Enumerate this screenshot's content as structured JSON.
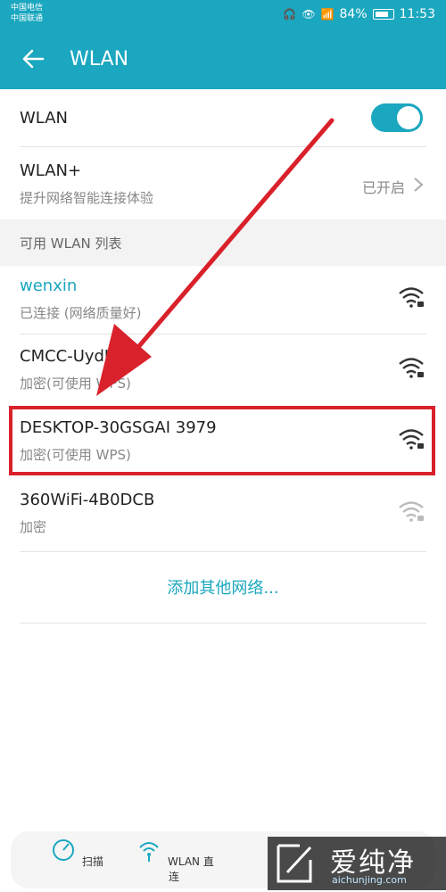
{
  "status_bar": {
    "carrier_1": "中国电信",
    "carrier_2": "中国联通",
    "battery": "84%",
    "time": "11:53"
  },
  "header": {
    "title": "WLAN"
  },
  "wlan_toggle": {
    "label": "WLAN",
    "on": true
  },
  "wlan_plus": {
    "label": "WLAN+",
    "subtitle": "提升网络智能连接体验",
    "status": "已开启"
  },
  "section": {
    "label": "可用 WLAN 列表"
  },
  "networks": [
    {
      "name": "wenxin",
      "status": "已连接 (网络质量好)",
      "connected": true
    },
    {
      "name": "CMCC-UydU",
      "status": "加密(可使用 WPS)",
      "connected": false
    },
    {
      "name": "DESKTOP-30GSGAI 3979",
      "status": "加密(可使用 WPS)",
      "connected": false,
      "highlighted": true
    },
    {
      "name": "360WiFi-4B0DCB",
      "status": "加密",
      "connected": false
    }
  ],
  "add_network": {
    "label": "添加其他网络..."
  },
  "bottom_nav": {
    "scan": "扫描",
    "wlan_direct": "WLAN 直连"
  },
  "watermark": {
    "brand": "爱纯净",
    "url": "aichunjing.com"
  },
  "colors": {
    "accent": "#1aa7bf",
    "annotation": "#d9212b"
  }
}
